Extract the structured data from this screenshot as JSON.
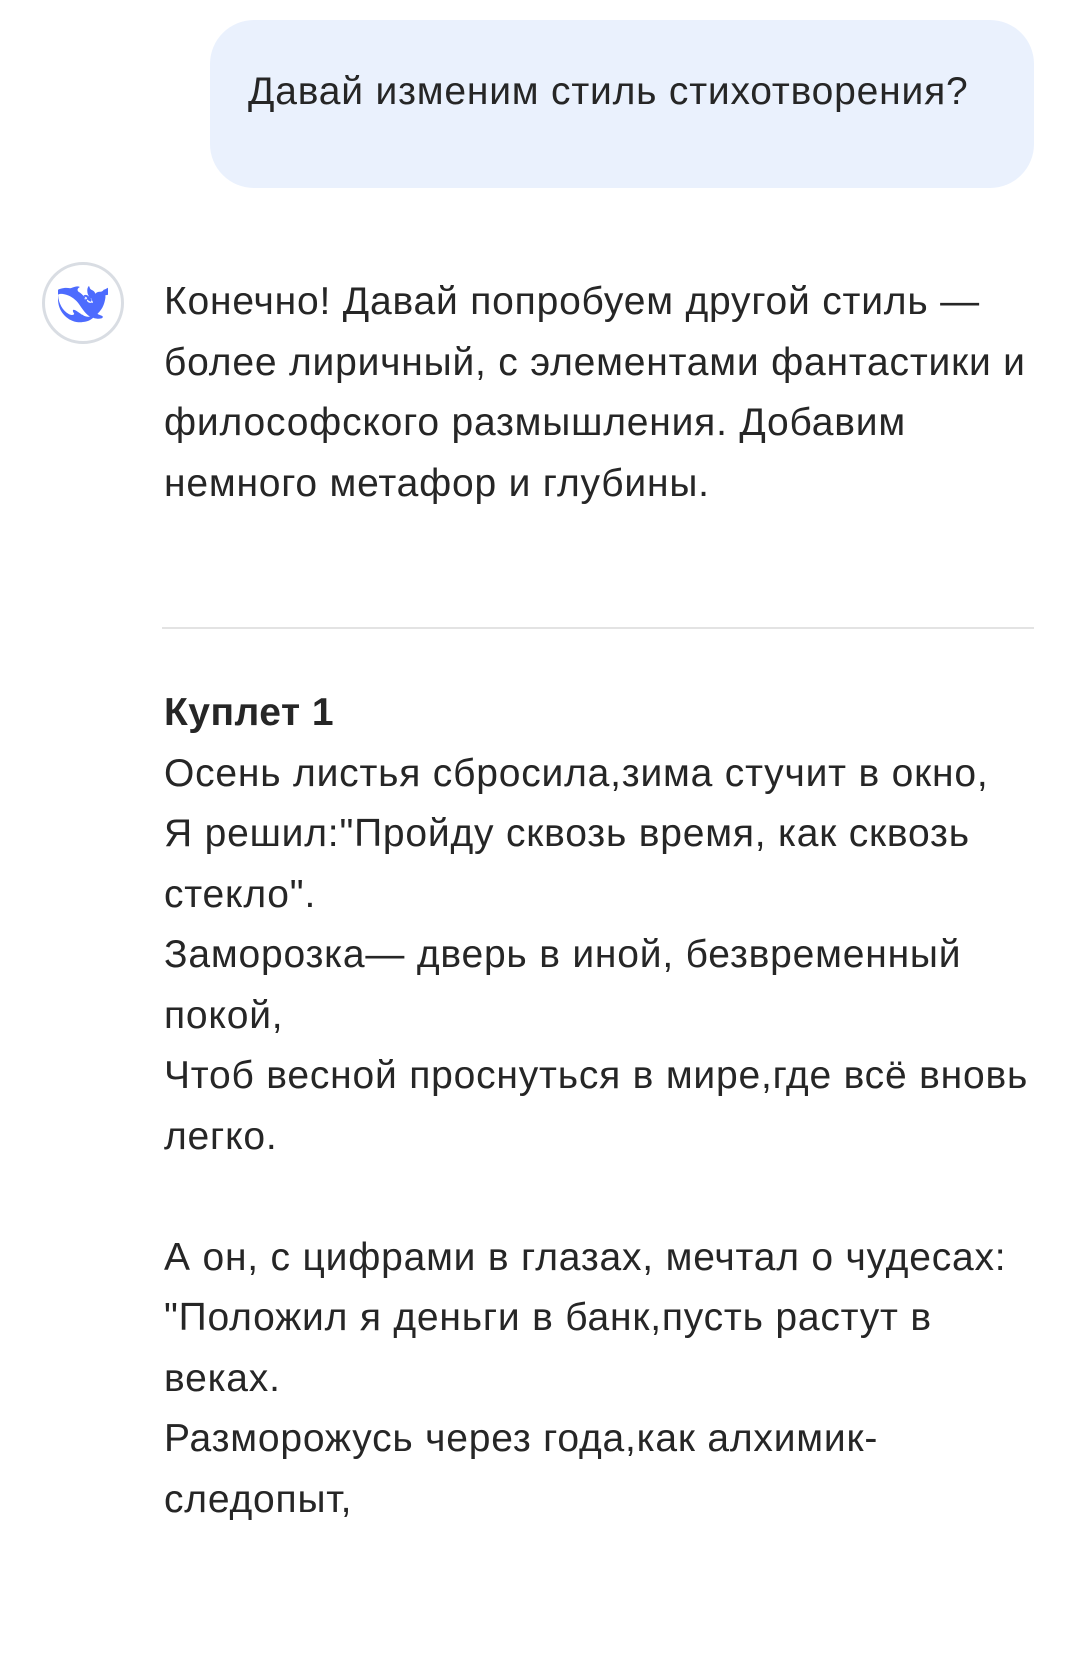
{
  "user_message": {
    "text": "Давай изменим стиль стихотворения?"
  },
  "assistant": {
    "avatar_icon": "whale-logo-icon",
    "avatar_color": "#4d6bfe",
    "intro": "Конечно! Давай попробуем другой стиль — более лиричный, с элементами фантастики и философского размышления. Добавим немного метафор и глубины.",
    "verse_heading": "Куплет 1",
    "stanza1": [
      "Осень листья сбросила,зима стучит в окно,",
      "Я решил:\"Пройду сквозь время, как сквозь стекло\".",
      "Заморозка— дверь в иной, безвременный покой,",
      "Чтоб весной проснуться в мире,где всё вновь легко."
    ],
    "stanza2": [
      "А он, с цифрами в глазах, мечтал о чудесах:",
      "\"Положил я деньги в банк,пусть растут в веках.",
      "Разморожусь через года,как алхимик-следопыт,"
    ]
  },
  "colors": {
    "user_bubble_bg": "#eaf1fd",
    "text": "#262626",
    "divider": "#e3e3e3"
  }
}
